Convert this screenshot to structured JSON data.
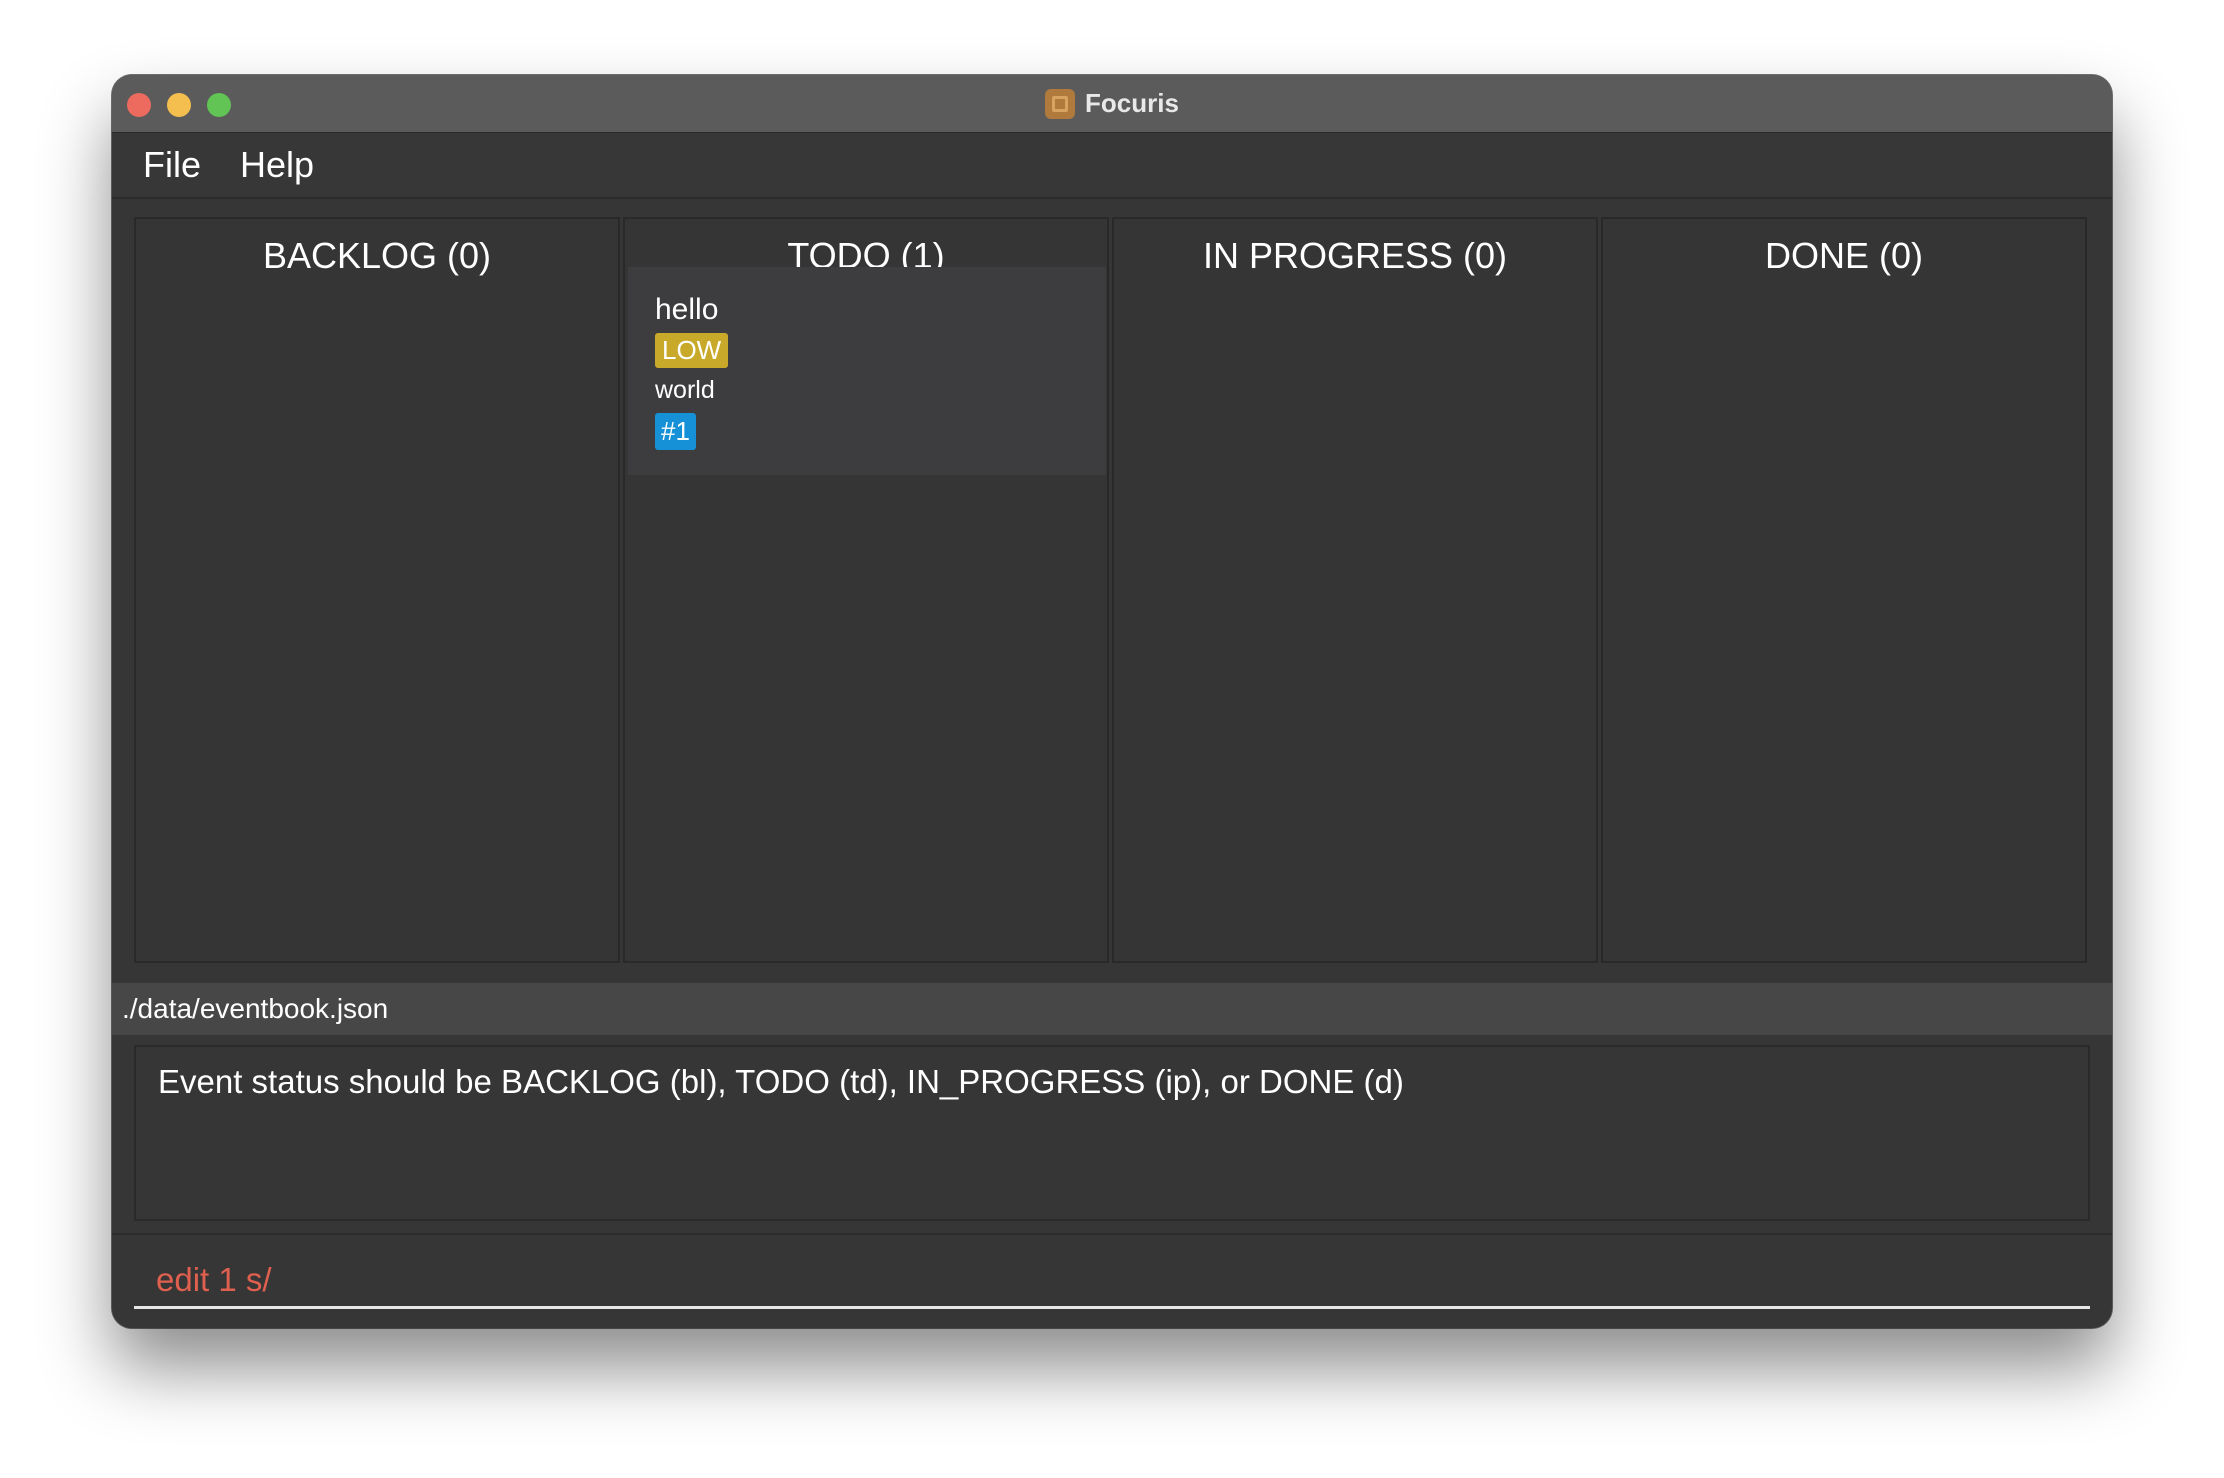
{
  "window": {
    "title": "Focuris",
    "controls": [
      "close",
      "minimize",
      "maximize"
    ]
  },
  "menu": {
    "items": [
      {
        "label": "File"
      },
      {
        "label": "Help"
      }
    ]
  },
  "columns": [
    {
      "header": "BACKLOG (0)"
    },
    {
      "header": "TODO (1)"
    },
    {
      "header": "IN PROGRESS (0)"
    },
    {
      "header": "DONE (0)"
    }
  ],
  "cards": [
    {
      "column": "TODO",
      "title": "hello",
      "priority": "LOW",
      "description": "world",
      "tag": "#1"
    }
  ],
  "status_bar": {
    "path": "./data/eventbook.json"
  },
  "result_display": {
    "message": "Event status should be BACKLOG (bl), TODO (td), IN_PROGRESS (ip), or DONE (d)"
  },
  "command_box": {
    "value": "edit 1 s/"
  },
  "colors": {
    "priority_low": "#c8a92a",
    "tag": "#1690d6",
    "command_text": "#e0604f",
    "background": "#363636"
  },
  "icons": {
    "app": "focuris-board-icon"
  }
}
